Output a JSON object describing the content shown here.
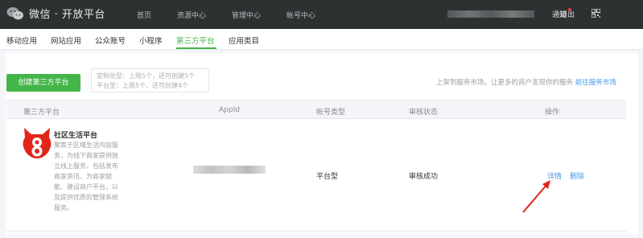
{
  "topbar": {
    "app_title": "微信 · 开放平台",
    "nav": [
      "首页",
      "资源中心",
      "管理中心",
      "帐号中心"
    ],
    "notify_label": "通知",
    "logout_label": "退出"
  },
  "tabs": [
    {
      "label": "移动应用"
    },
    {
      "label": "网站应用"
    },
    {
      "label": "公众账号"
    },
    {
      "label": "小程序"
    },
    {
      "label": "第三方平台"
    },
    {
      "label": "应用类目"
    }
  ],
  "toolbar": {
    "create_label": "创建第三方平台",
    "quota_line1": "定制化型：上限5个，还可创建5个",
    "quota_line2": "平台型：上限5个，还可创建4个",
    "market_tip": "上架到服务市场，让更多的商户发现你的服务",
    "market_link": "前往服务市场"
  },
  "table": {
    "headers": [
      "第三方平台",
      "AppId",
      "帐号类型",
      "审核状态",
      "操作"
    ],
    "rows": [
      {
        "name": "社区生活平台",
        "description": "聚焦于区域生活内容服务，为线下商家提供独立线上服务，包括发布商家资讯、为商家赋能、建设商户平台，以及提供优质的管理系统服务。",
        "type": "平台型",
        "status": "审核成功",
        "detail_label": "详情",
        "delete_label": "删除"
      }
    ]
  },
  "colors": {
    "accent": "#44b549",
    "link": "#459ae9",
    "topbar": "#2e3132",
    "annotation_arrow": "#e1251b"
  }
}
